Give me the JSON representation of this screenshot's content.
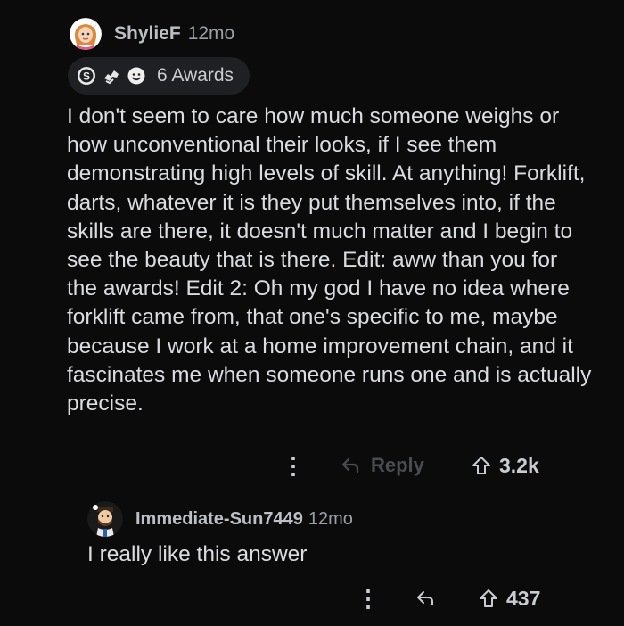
{
  "comment": {
    "username": "ShylieF",
    "time_ago": "12mo",
    "awards_label": "6 Awards",
    "body": "I don't seem to care how much someone weighs or how unconventional their looks, if I see them demonstrating high levels of skill. At anything! Forklift, darts, whatever it is they put themselves into, if the skills are there, it doesn't much matter and I begin to see the beauty that is there. Edit: aww than you for the awards! Edit 2: Oh my god I have no idea where forklift came from, that one's specific to me, maybe because I work at a home improvement chain, and it fascinates me when someone runs one and is actually precise.",
    "more_glyph": "⋮",
    "reply_label": "Reply",
    "vote_count": "3.2k"
  },
  "reply": {
    "username": "Immediate-Sun7449",
    "time_ago": "12mo",
    "body": "I really like this answer",
    "more_glyph": "⋮",
    "vote_count": "437"
  },
  "colors": {
    "background": "#0b0b0c",
    "text": "#dadcdf",
    "muted": "#9aa0a6",
    "disabled": "#4a4c50",
    "pill": "#1f2023"
  },
  "icons": [
    "avatar-shylief",
    "award-silver-icon",
    "award-helpful-icon",
    "award-wholesome-icon",
    "reply-arrow-icon",
    "upvote-arrow-icon",
    "avatar-immediate-sun"
  ]
}
